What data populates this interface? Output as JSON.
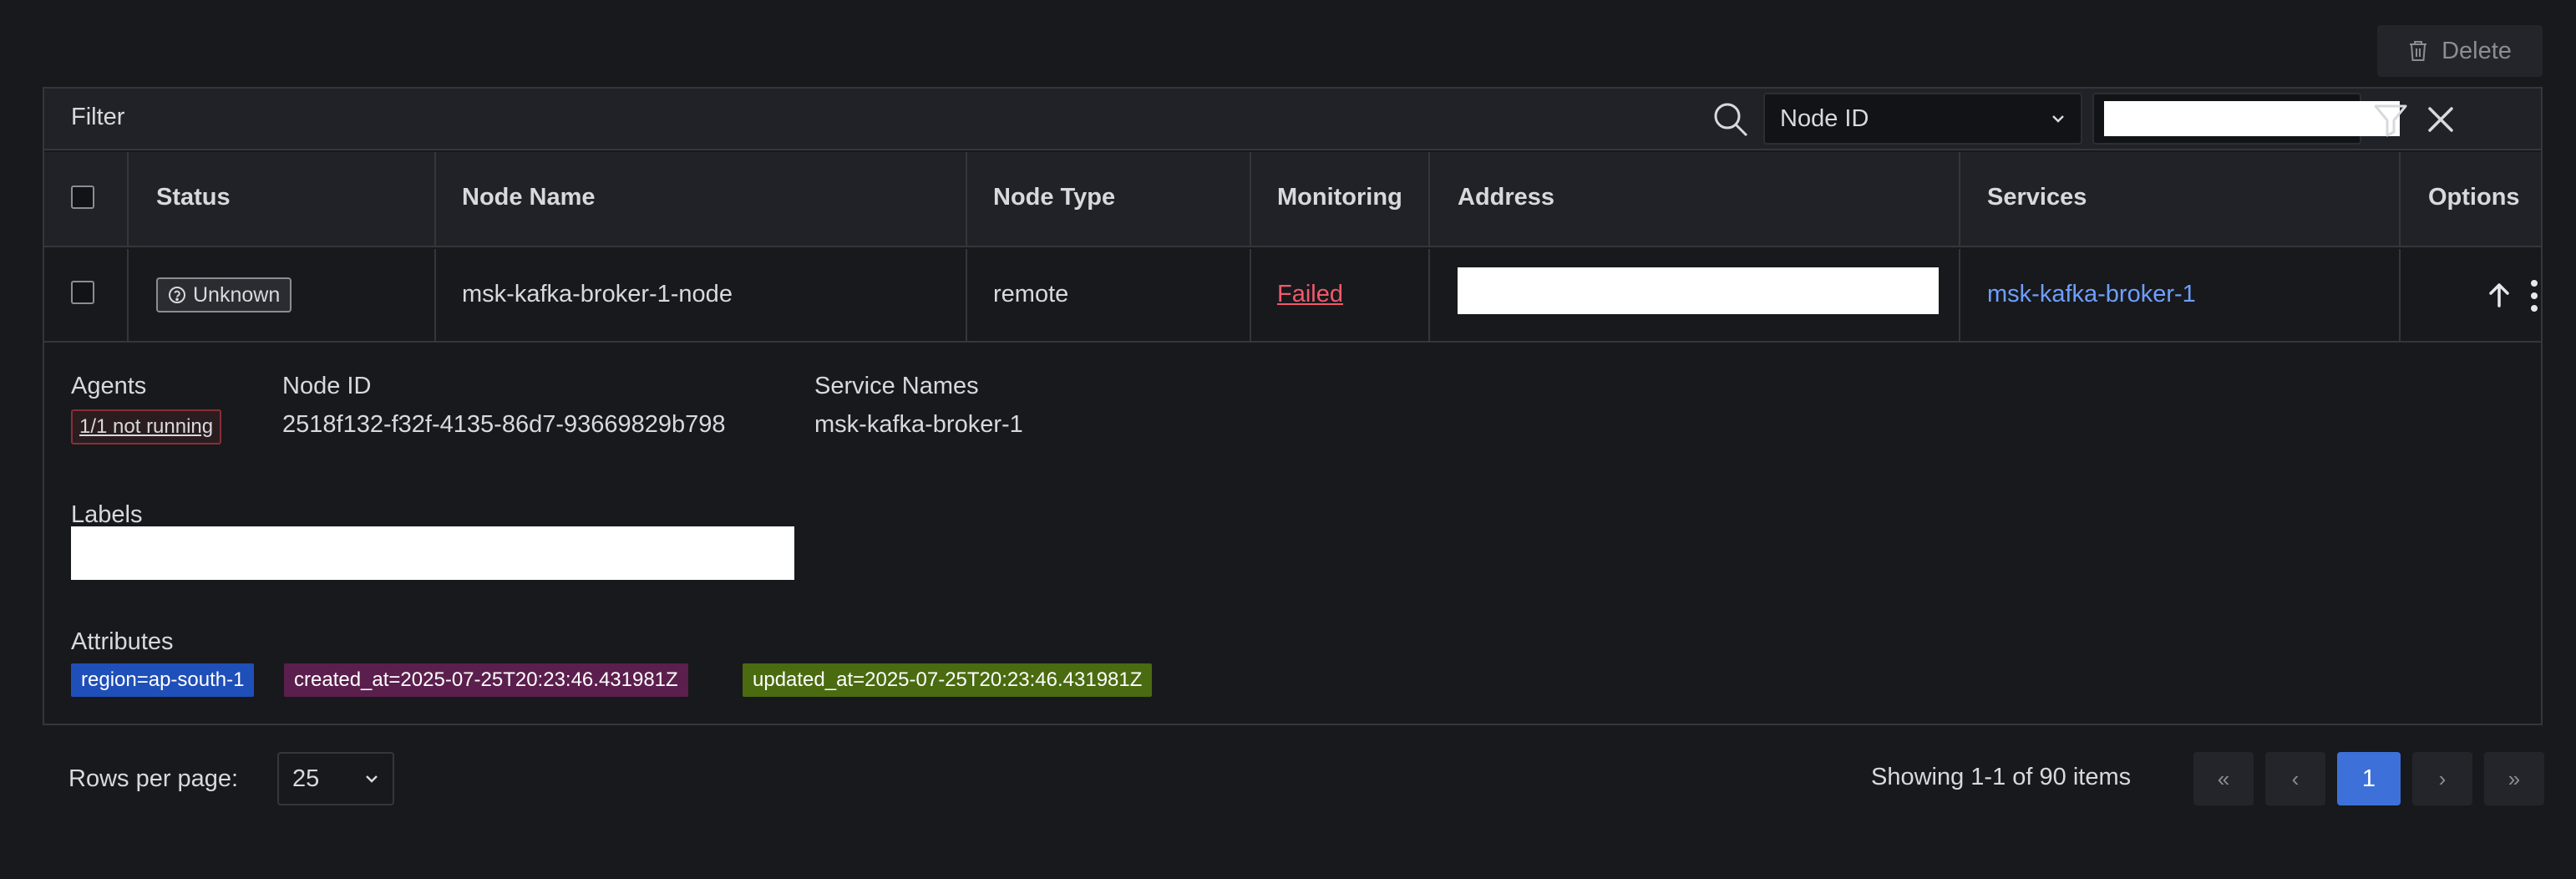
{
  "toolbar": {
    "delete_label": "Delete"
  },
  "filter": {
    "label": "Filter",
    "field_select_value": "Node ID",
    "field_input_value": ""
  },
  "table": {
    "headers": [
      "Status",
      "Node Name",
      "Node Type",
      "Monitoring",
      "Address",
      "Services",
      "Options"
    ],
    "row": {
      "status": "Unknown",
      "node_name": "msk-kafka-broker-1-node",
      "node_type": "remote",
      "monitoring": "Failed",
      "address": "",
      "services": "msk-kafka-broker-1"
    }
  },
  "details": {
    "agents_label": "Agents",
    "agents_value": "1/1 not running",
    "node_id_label": "Node ID",
    "node_id_value": "2518f132-f32f-4135-86d7-93669829b798",
    "service_names_label": "Service Names",
    "service_names_value": "msk-kafka-broker-1",
    "labels_label": "Labels",
    "labels_value": "",
    "attributes_label": "Attributes",
    "attributes": [
      {
        "text": "region=ap-south-1",
        "color": "#1f4fb8"
      },
      {
        "text": "created_at=2025-07-25T20:23:46.431981Z",
        "color": "#5b1f4d"
      },
      {
        "text": "updated_at=2025-07-25T20:23:46.431981Z",
        "color": "#4a6b10"
      }
    ]
  },
  "pagination": {
    "rows_per_page_label": "Rows per page:",
    "rows_per_page_value": "25",
    "summary": "Showing 1-1 of 90 items",
    "first": "«",
    "prev": "‹",
    "current_page": "1",
    "next": "›",
    "last": "»"
  },
  "colors": {
    "background": "#18191d",
    "accent": "#3d71d9",
    "link": "#6e9fff",
    "error": "#f05a6a"
  }
}
